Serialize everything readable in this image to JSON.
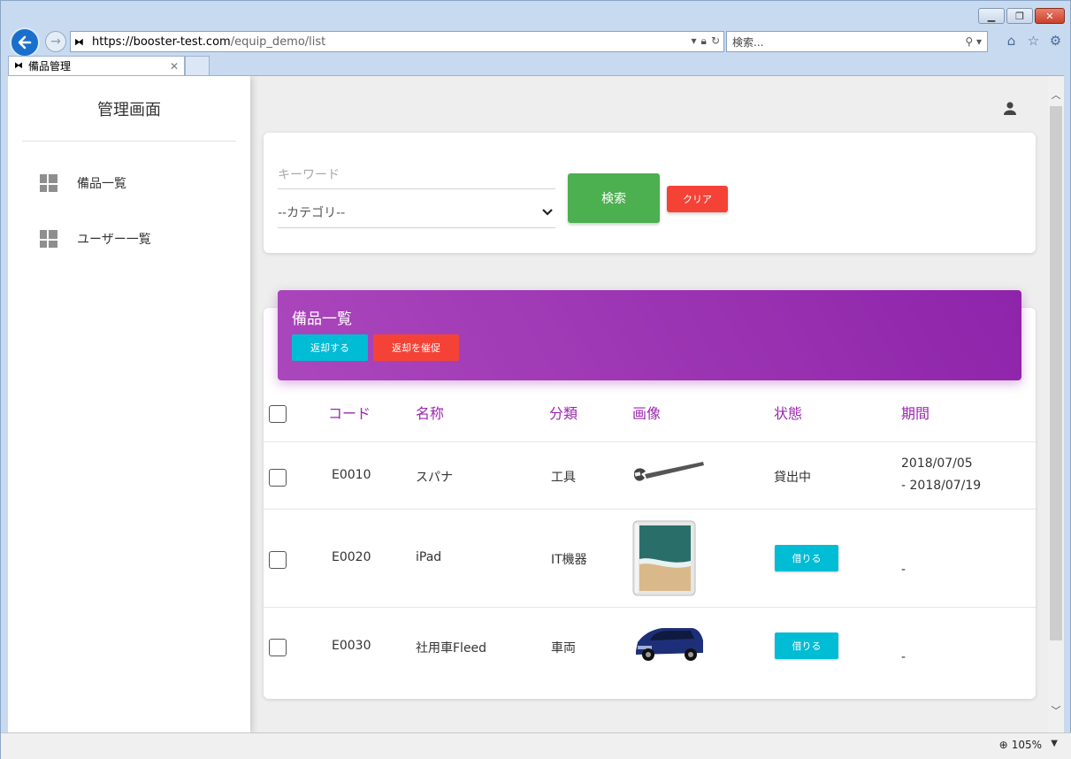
{
  "browser": {
    "url_host": "https://booster-test.com",
    "url_path": "/equip_demo/list",
    "search_placeholder": "検索...",
    "tab_title": "備品管理",
    "zoom_level": "105%"
  },
  "sidebar": {
    "title": "管理画面",
    "items": [
      {
        "label": "備品一覧"
      },
      {
        "label": "ユーザー一覧"
      }
    ]
  },
  "search_form": {
    "keyword_placeholder": "キーワード",
    "category_selected": "--カテゴリ--",
    "search_label": "検索",
    "clear_label": "クリア"
  },
  "list": {
    "title": "備品一覧",
    "return_label": "返却する",
    "urge_label": "返却を催促",
    "columns": [
      "コード",
      "名称",
      "分類",
      "画像",
      "状態",
      "期間"
    ],
    "rows": [
      {
        "code": "E0010",
        "name": "スパナ",
        "category": "工具",
        "image": "spanner-image",
        "status": "貸出中",
        "period_start": "2018/07/05",
        "period_end": "- 2018/07/19"
      },
      {
        "code": "E0020",
        "name": "iPad",
        "category": "IT機器",
        "image": "ipad-image",
        "status_button": "借りる",
        "period": "-"
      },
      {
        "code": "E0030",
        "name": "社用車Fleed",
        "category": "車両",
        "image": "car-image",
        "status_button": "借りる",
        "period": "-"
      }
    ]
  },
  "colors": {
    "primary_purple": "#9c27b0",
    "success_green": "#4caf50",
    "danger_red": "#f44336",
    "info_cyan": "#00bcd4"
  }
}
